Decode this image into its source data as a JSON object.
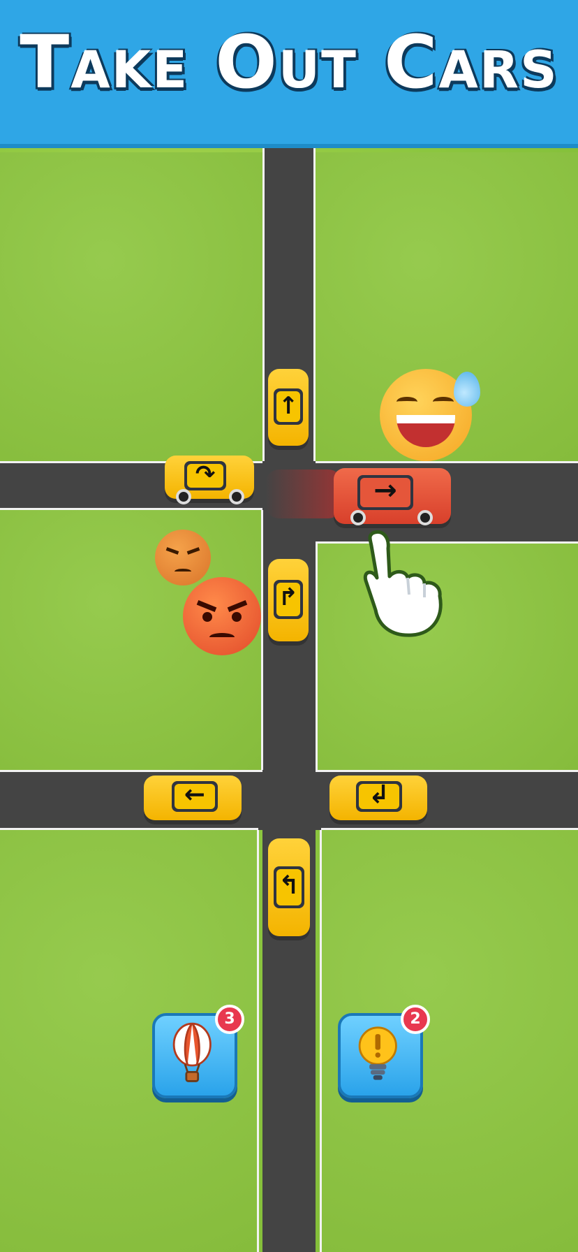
{
  "header": {
    "title": "Take Out Cars",
    "color": "#2fa6e6"
  },
  "board": {
    "road_color": "#444444",
    "grass_color": "#8dc63f",
    "cars": [
      {
        "id": "taxi-north",
        "color": "yellow",
        "direction": "up",
        "arrow": "↑"
      },
      {
        "id": "taxi-west-road",
        "color": "yellow",
        "direction": "turn-right-down",
        "arrow": "↷"
      },
      {
        "id": "red-car",
        "color": "red",
        "direction": "right",
        "arrow": "→"
      },
      {
        "id": "taxi-center",
        "color": "yellow",
        "direction": "turn-right-up",
        "arrow": "↱"
      },
      {
        "id": "taxi-left-lower",
        "color": "yellow",
        "direction": "left",
        "arrow": "←"
      },
      {
        "id": "taxi-right-lower",
        "color": "yellow",
        "direction": "turn-left-down",
        "arrow": "↲"
      },
      {
        "id": "taxi-south",
        "color": "yellow",
        "direction": "turn-left-up",
        "arrow": "↰"
      }
    ],
    "emojis": [
      "laughing-sweat-emoji",
      "angry-emoji-small",
      "angry-emoji-large"
    ]
  },
  "boosters": [
    {
      "icon": "hot-air-balloon-icon",
      "count": "3"
    },
    {
      "icon": "lightbulb-icon",
      "count": "2"
    }
  ]
}
